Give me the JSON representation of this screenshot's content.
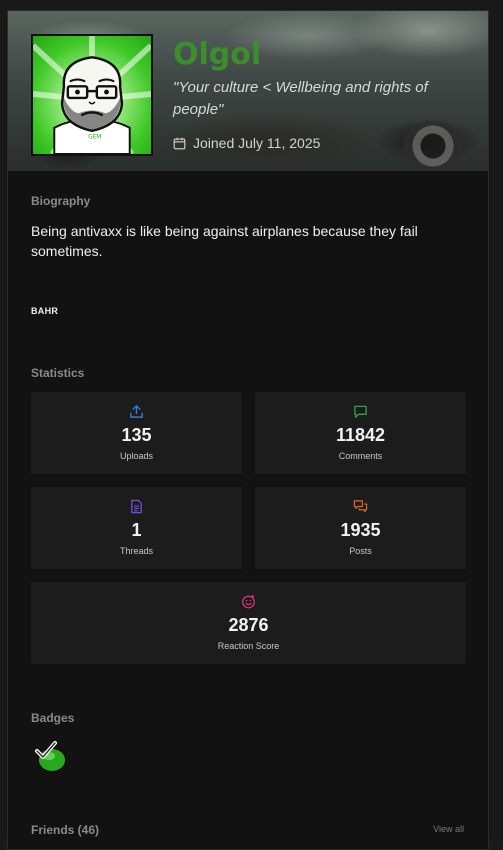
{
  "profile": {
    "username": "Olgol",
    "motto": "\"Your culture < Wellbeing and rights of people\"",
    "joined": "Joined July 11, 2025",
    "username_color": "#3a8f2a"
  },
  "biography": {
    "title": "Biography",
    "text": "Being antivaxx is like being against airplanes because they fail sometimes.",
    "signature": "BAHR"
  },
  "statistics": {
    "title": "Statistics",
    "items": [
      {
        "value": "135",
        "label": "Uploads",
        "icon": "upload-icon",
        "color": "#2f7fd6"
      },
      {
        "value": "11842",
        "label": "Comments",
        "icon": "comment-icon",
        "color": "#2fa34a"
      },
      {
        "value": "1",
        "label": "Threads",
        "icon": "document-icon",
        "color": "#7b4bd4"
      },
      {
        "value": "1935",
        "label": "Posts",
        "icon": "chat-bubbles-icon",
        "color": "#d9691f"
      },
      {
        "value": "2876",
        "label": "Reaction Score",
        "icon": "smiley-icon",
        "color": "#d4317a"
      }
    ]
  },
  "badges": {
    "title": "Badges",
    "items": [
      {
        "icon": "check-badge-icon"
      }
    ]
  },
  "friends": {
    "title": "Friends (46)",
    "view_all": "View all"
  }
}
